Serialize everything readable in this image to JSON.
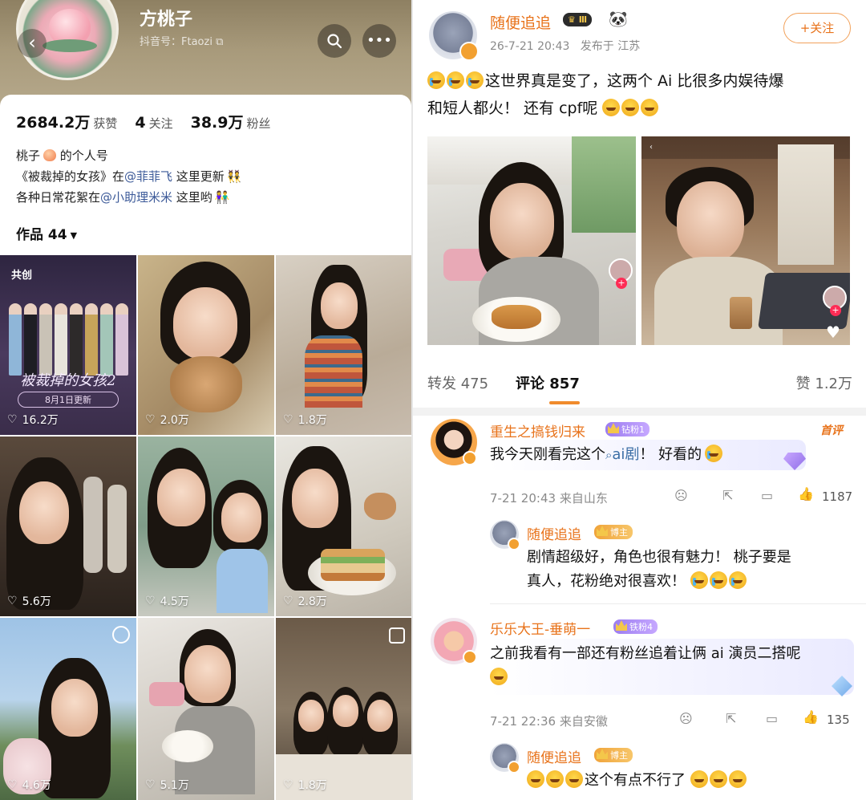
{
  "profile": {
    "name": "方桃子",
    "douyin_id": "抖音号：Ftaozi",
    "stats": [
      {
        "value": "2684.2万",
        "label": "获赞"
      },
      {
        "value": "4",
        "label": "关注"
      },
      {
        "value": "38.9万",
        "label": "粉丝"
      }
    ],
    "bio": {
      "line1_prefix": "桃子",
      "line1_suffix": " 的个人号",
      "line2_prefix": "《被裁掉的女孩》在",
      "line2_mention": "@菲菲飞",
      "line2_suffix": " 这里更新",
      "line3_prefix": "各种日常花絮在",
      "line3_mention": "@小助理米米",
      "line3_suffix": " 这里哟"
    },
    "works_label": "作品 44",
    "tiles": [
      {
        "likes": "16.2万",
        "badge": "共创",
        "poster_title": "被裁掉的女孩2",
        "poster_date": "8月1日更新"
      },
      {
        "likes": "2.0万"
      },
      {
        "likes": "1.8万"
      },
      {
        "likes": "5.6万"
      },
      {
        "likes": "4.5万"
      },
      {
        "likes": "2.8万"
      },
      {
        "likes": "4.6万"
      },
      {
        "likes": "5.1万"
      },
      {
        "likes": "1.8万"
      }
    ]
  },
  "post": {
    "author": "随便追追",
    "vip_level": "Ⅲ",
    "time": "26-7-21 20:43",
    "location": "发布于 江苏",
    "follow_label": "+关注",
    "text_line1": "这世界真是变了，这两个 Ai 比很多内娱待爆",
    "text_line2": "和短人都火！ 还有 cpf呢",
    "tabs": {
      "repost": "转发 475",
      "comments": "评论 857",
      "likes": "赞 1.2万"
    }
  },
  "comments": [
    {
      "name": "重生之搞钱归来",
      "badge": "钻粉1",
      "hot": "首评",
      "text_prefix": "我今天刚看完这个",
      "text_link": "ai剧",
      "text_suffix": "！ 好看的",
      "time": "7-21 20:43",
      "from": "来自山东",
      "likes": "1187"
    },
    {
      "name": "随便追追",
      "badge": "博主",
      "text_line1": "剧情超级好，角色也很有魅力！ 桃子要是",
      "text_line2": "真人，花粉绝对很喜欢！"
    },
    {
      "name": "乐乐大王-垂萌一",
      "badge": "铁粉4",
      "text_line1": "之前我看有一部还有粉丝追着让俩 ai 演员二搭呢",
      "time": "7-21 22:36",
      "from": "来自安徽",
      "likes": "135"
    },
    {
      "name": "随便追追",
      "badge": "博主",
      "text": "这个有点不行了"
    }
  ],
  "colors": {
    "accent": "#e8731b",
    "link": "#3b5998",
    "tab_underline": "#f08b2c"
  }
}
